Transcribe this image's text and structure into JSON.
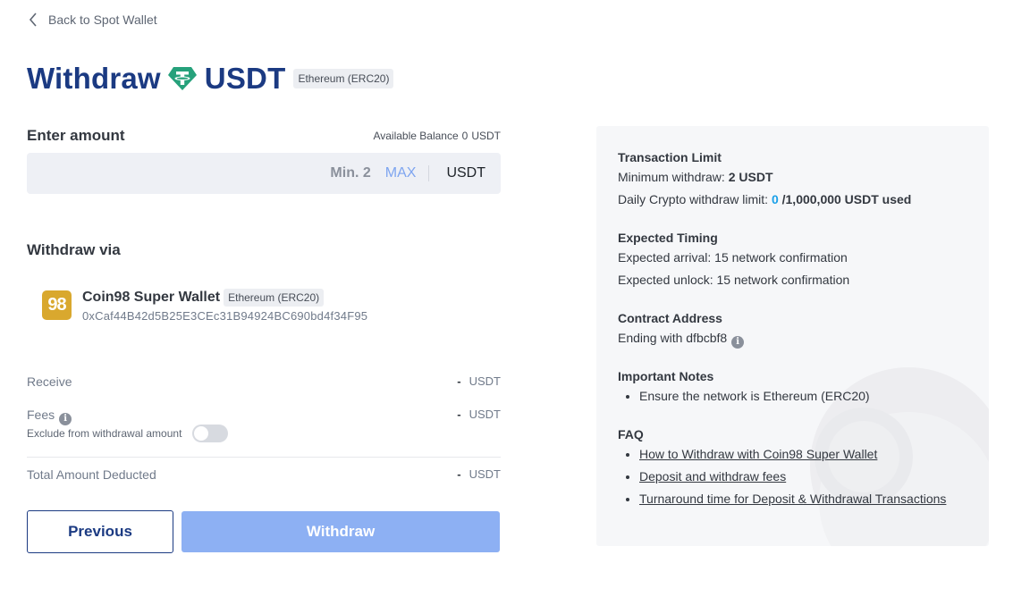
{
  "nav": {
    "back_label": "Back to Spot Wallet"
  },
  "header": {
    "withdraw_word": "Withdraw",
    "coin": "USDT",
    "network_badge": "Ethereum (ERC20)"
  },
  "amount": {
    "label": "Enter amount",
    "available_label": "Available Balance",
    "available_value": "0",
    "available_unit": "USDT",
    "input_value": "",
    "min_label": "Min. 2",
    "max_label": "MAX",
    "unit": "USDT"
  },
  "via": {
    "label": "Withdraw via",
    "wallet_logo": "98",
    "wallet_name": "Coin98 Super Wallet",
    "wallet_network": "Ethereum (ERC20)",
    "wallet_address": "0xCaf44B42d5B25E3CEc31B94924BC690bd4f34F95"
  },
  "summary": {
    "receive_label": "Receive",
    "receive_value": "-",
    "receive_unit": "USDT",
    "fees_label": "Fees",
    "fees_value": "-",
    "fees_unit": "USDT",
    "exclude_label": "Exclude from withdrawal amount",
    "exclude_toggle_on": false,
    "total_label": "Total Amount Deducted",
    "total_value": "-",
    "total_unit": "USDT"
  },
  "buttons": {
    "previous": "Previous",
    "withdraw": "Withdraw"
  },
  "info_panel": {
    "limit_title": "Transaction Limit",
    "min_withdraw_label": "Minimum withdraw:",
    "min_withdraw_value": "2 USDT",
    "daily_limit_label": "Daily Crypto withdraw limit:",
    "daily_limit_used": "0",
    "daily_limit_rest": "/1,000,000 USDT used",
    "timing_title": "Expected Timing",
    "arrival": "Expected arrival: 15 network confirmation",
    "unlock": "Expected unlock: 15 network confirmation",
    "contract_title": "Contract Address",
    "contract_ending": "Ending with dfbcbf8",
    "notes_title": "Important Notes",
    "notes": [
      "Ensure the network is Ethereum (ERC20)"
    ],
    "faq_title": "FAQ",
    "faq": [
      "How to Withdraw with Coin98 Super Wallet",
      "Deposit and withdraw fees",
      "Turnaround time for Deposit & Withdrawal Transactions"
    ]
  },
  "colors": {
    "brand": "#1b3a82",
    "token_green": "#26a17b",
    "withdraw_disabled": "#8db0f3",
    "link_blue": "#7ea5f0"
  },
  "icons": {
    "back": "chevron-left-icon",
    "token": "tether-icon",
    "info": "info-icon"
  }
}
